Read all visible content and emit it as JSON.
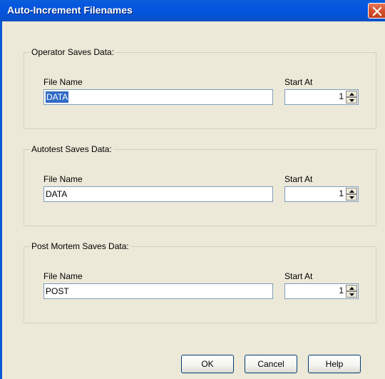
{
  "window": {
    "title": "Auto-Increment Filenames"
  },
  "groups": [
    {
      "legend": "Operator Saves Data:",
      "file_name_label": "File Name",
      "file_name_value": "DATA",
      "start_at_label": "Start At",
      "start_at_value": "1"
    },
    {
      "legend": "Autotest Saves Data:",
      "file_name_label": "File Name",
      "file_name_value": "DATA",
      "start_at_label": "Start At",
      "start_at_value": "1"
    },
    {
      "legend": "Post Mortem Saves Data:",
      "file_name_label": "File Name",
      "file_name_value": "POST",
      "start_at_label": "Start At",
      "start_at_value": "1"
    }
  ],
  "buttons": {
    "ok": "OK",
    "cancel": "Cancel",
    "help": "Help"
  },
  "icons": {
    "close": "close-icon",
    "spin_up": "spin-up-icon",
    "spin_down": "spin-down-icon"
  }
}
